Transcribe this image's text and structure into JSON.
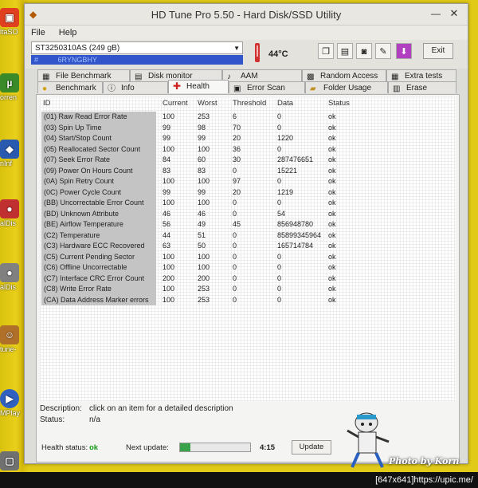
{
  "window": {
    "title": "HD Tune Pro 5.50 - Hard Disk/SSD Utility"
  },
  "menu": {
    "file": "File",
    "help": "Help"
  },
  "toolbar": {
    "drive": "ST3250310AS (249 gB)",
    "serial_prefix": "#",
    "serial": "6RYNGBHY",
    "temperature": "44°C",
    "exit_label": "Exit"
  },
  "tabs_top": [
    "File Benchmark",
    "Disk monitor",
    "AAM",
    "Random Access",
    "Extra tests"
  ],
  "tabs_bottom": [
    "Benchmark",
    "Info",
    "Health",
    "Error Scan",
    "Folder Usage",
    "Erase"
  ],
  "table": {
    "headers": [
      "ID",
      "Current",
      "Worst",
      "Threshold",
      "Data",
      "Status"
    ],
    "rows": [
      [
        "(01) Raw Read Error Rate",
        "100",
        "253",
        "6",
        "0",
        "ok"
      ],
      [
        "(03) Spin Up Time",
        "99",
        "98",
        "70",
        "0",
        "ok"
      ],
      [
        "(04) Start/Stop Count",
        "99",
        "99",
        "20",
        "1220",
        "ok"
      ],
      [
        "(05) Reallocated Sector Count",
        "100",
        "100",
        "36",
        "0",
        "ok"
      ],
      [
        "(07) Seek Error Rate",
        "84",
        "60",
        "30",
        "287476651",
        "ok"
      ],
      [
        "(09) Power On Hours Count",
        "83",
        "83",
        "0",
        "15221",
        "ok"
      ],
      [
        "(0A) Spin Retry Count",
        "100",
        "100",
        "97",
        "0",
        "ok"
      ],
      [
        "(0C) Power Cycle Count",
        "99",
        "99",
        "20",
        "1219",
        "ok"
      ],
      [
        "(BB) Uncorrectable Error Count",
        "100",
        "100",
        "0",
        "0",
        "ok"
      ],
      [
        "(BD) Unknown Attribute",
        "46",
        "46",
        "0",
        "54",
        "ok"
      ],
      [
        "(BE) Airflow Temperature",
        "56",
        "49",
        "45",
        "856948780",
        "ok"
      ],
      [
        "(C2) Temperature",
        "44",
        "51",
        "0",
        "85899345964",
        "ok"
      ],
      [
        "(C3) Hardware ECC Recovered",
        "63",
        "50",
        "0",
        "165714784",
        "ok"
      ],
      [
        "(C5) Current Pending Sector",
        "100",
        "100",
        "0",
        "0",
        "ok"
      ],
      [
        "(C6) Offline Uncorrectable",
        "100",
        "100",
        "0",
        "0",
        "ok"
      ],
      [
        "(C7) Interface CRC Error Count",
        "200",
        "200",
        "0",
        "0",
        "ok"
      ],
      [
        "(C8) Write Error Rate",
        "100",
        "253",
        "0",
        "0",
        "ok"
      ],
      [
        "(CA) Data Address Marker errors",
        "100",
        "253",
        "0",
        "0",
        "ok"
      ]
    ]
  },
  "description": {
    "label": "Description:",
    "value": "click on an item for a detailed description",
    "status_label": "Status:",
    "status_value": "n/a"
  },
  "statusbar": {
    "health_label": "Health status:",
    "health_value": "ok",
    "next_update_label": "Next update:",
    "progress_fraction": 0.15,
    "countdown": "4:15",
    "update_label": "Update"
  },
  "desktop_icons": [
    "ltaSO",
    "orren",
    "nInf",
    "alDis",
    "alDis",
    "tune-",
    "MPlay"
  ],
  "watermark": "Photo by Korn",
  "image_footer": "[647x641]https://upic.me/",
  "colors": {
    "health_ok": "#1a9a1a",
    "serial_bg": "#3355cc",
    "progress": "#3aa34a"
  }
}
